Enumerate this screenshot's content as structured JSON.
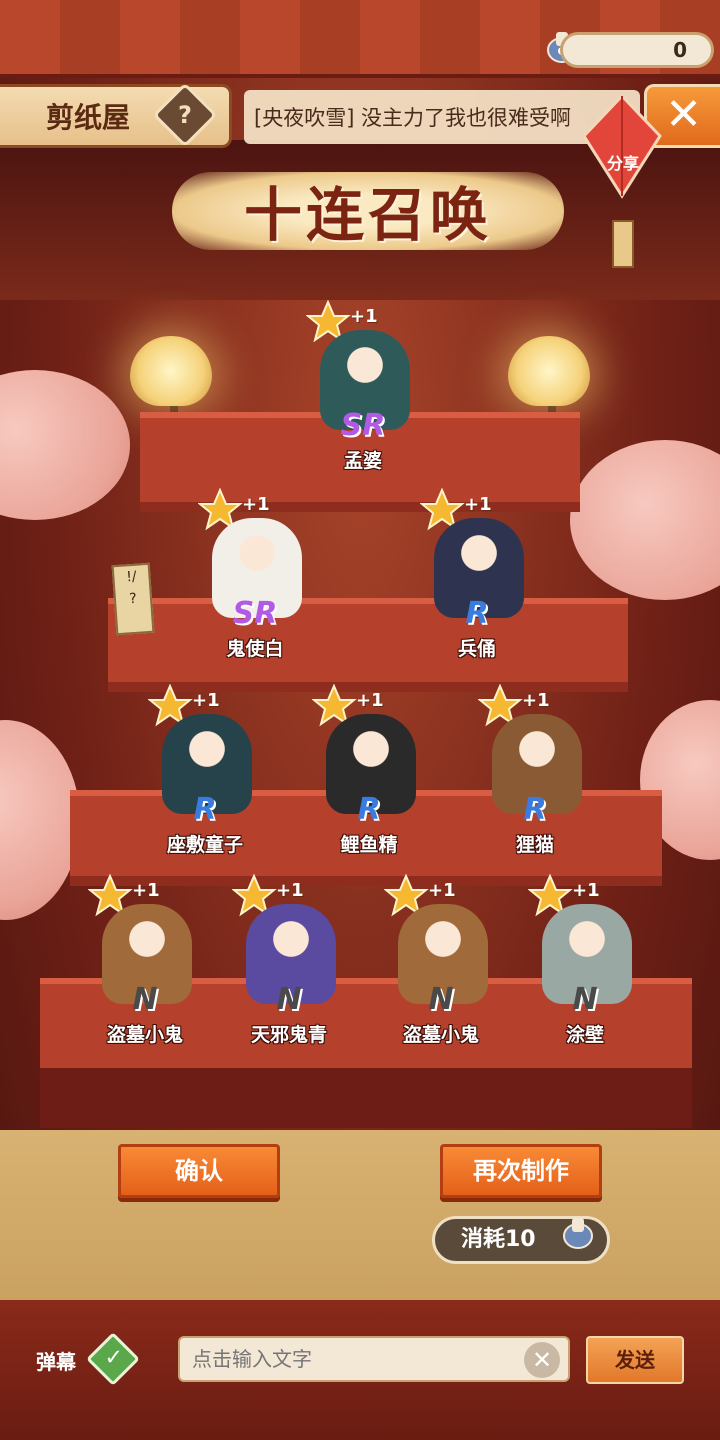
{
  "header": {
    "title": "剪纸屋",
    "help_icon": "question-icon",
    "marquee": "[央夜吹雪] 没主力了我也很难受啊",
    "close_icon": "close-x-icon",
    "currency_value": "0",
    "share_label": "分享"
  },
  "banner": {
    "title": "十连召唤"
  },
  "sign_text": "!/\n?",
  "results": [
    {
      "name": "孟婆",
      "rarity": "SR",
      "plus": "+1",
      "color": "#2f5a5a"
    },
    {
      "name": "鬼使白",
      "rarity": "SR",
      "plus": "+1",
      "color": "#f2efe9"
    },
    {
      "name": "兵俑",
      "rarity": "R",
      "plus": "+1",
      "color": "#2e3450"
    },
    {
      "name": "座敷童子",
      "rarity": "R",
      "plus": "+1",
      "color": "#26424a"
    },
    {
      "name": "鲤鱼精",
      "rarity": "R",
      "plus": "+1",
      "color": "#2a2a2a"
    },
    {
      "name": "狸猫",
      "rarity": "R",
      "plus": "+1",
      "color": "#8a5a34"
    },
    {
      "name": "盗墓小鬼",
      "rarity": "N",
      "plus": "+1",
      "color": "#a06a3a"
    },
    {
      "name": "天邪鬼青",
      "rarity": "N",
      "plus": "+1",
      "color": "#5a4aa0"
    },
    {
      "name": "盗墓小鬼",
      "rarity": "N",
      "plus": "+1",
      "color": "#a06a3a"
    },
    {
      "name": "涂壁",
      "rarity": "N",
      "plus": "+1",
      "color": "#9aa8a4"
    }
  ],
  "actions": {
    "confirm": "确认",
    "redo": "再次制作",
    "cost": "消耗10"
  },
  "chat": {
    "danmu_label": "弹幕",
    "placeholder": "点击输入文字",
    "send": "发送"
  }
}
